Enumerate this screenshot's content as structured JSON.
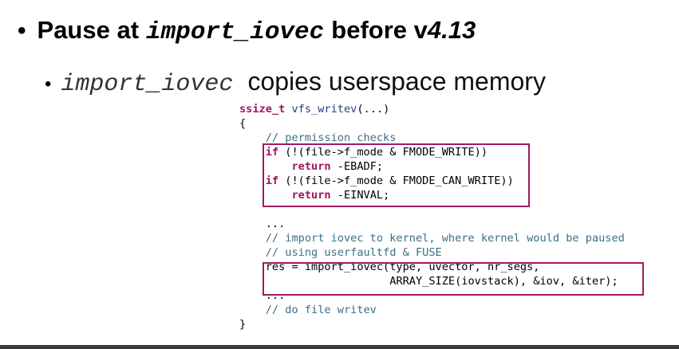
{
  "slide": {
    "bullet1": {
      "prefix": "Pause at",
      "code": "import_iovec",
      "mid": "before v",
      "version": "4.13"
    },
    "bullet2": {
      "code": "import_iovec",
      "text": "copies userspace memory"
    },
    "code": {
      "line1_type": "ssize_t",
      "line1_fn": "vfs_writev",
      "line1_rest": "(...)",
      "line2": "{",
      "line3": "    // permission checks",
      "line4_kw": "if",
      "line4_rest": " (!(file->f_mode & FMODE_WRITE))",
      "line5_kw": "return",
      "line5_rest": " -EBADF;",
      "line6_kw": "if",
      "line6_rest": " (!(file->f_mode & FMODE_CAN_WRITE))",
      "line7_kw": "return",
      "line7_rest": " -EINVAL;",
      "line9": "    ...",
      "line10": "    // import iovec to kernel, where kernel would be paused",
      "line11": "    // using userfaultfd & FUSE",
      "line12": "    res = import_iovec(type, uvector, nr_segs,",
      "line13": "                       ARRAY_SIZE(iovstack), &iov, &iter);",
      "line14": "    ...",
      "line15": "    // do file writev",
      "line16": "}"
    }
  }
}
